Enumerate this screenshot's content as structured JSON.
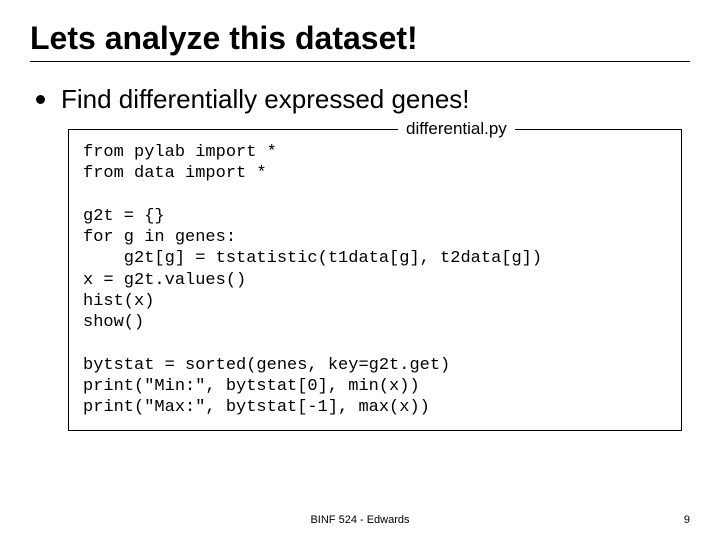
{
  "slide": {
    "title": "Lets analyze this dataset!",
    "bullet": "Find differentially expressed genes!",
    "legend": "differential.py",
    "code": "from pylab import *\nfrom data import *\n\ng2t = {}\nfor g in genes:\n    g2t[g] = tstatistic(t1data[g], t2data[g])\nx = g2t.values()\nhist(x)\nshow()\n\nbytstat = sorted(genes, key=g2t.get)\nprint(\"Min:\", bytstat[0], min(x))\nprint(\"Max:\", bytstat[-1], max(x))",
    "footer": "BINF 524 - Edwards",
    "page": "9"
  }
}
